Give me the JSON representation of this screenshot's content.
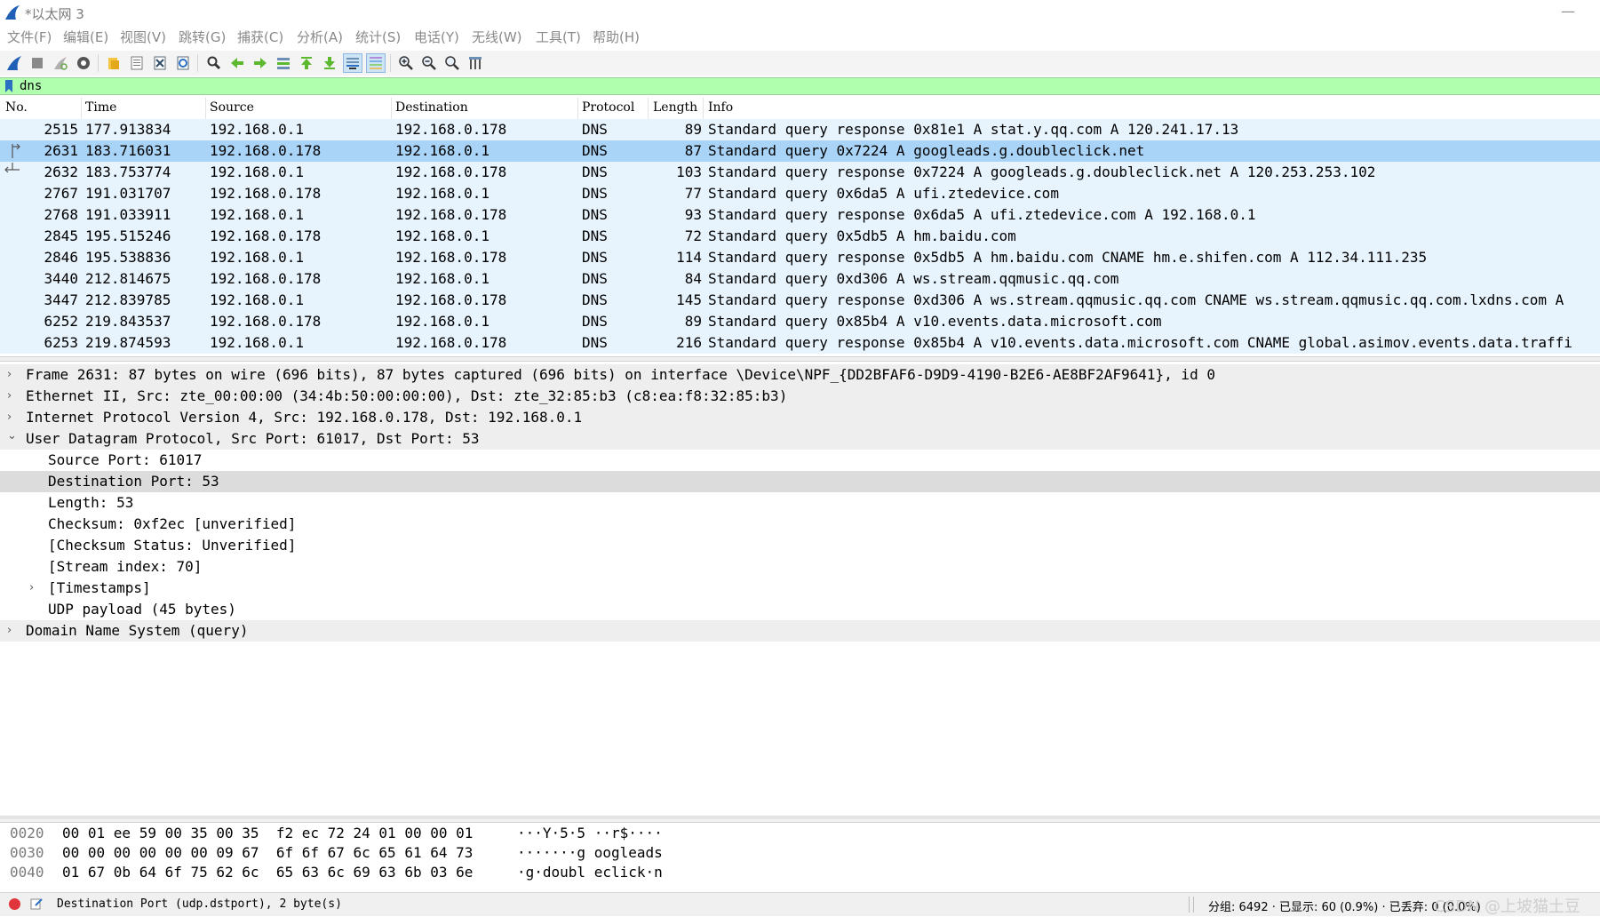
{
  "window": {
    "title": "*以太网 3",
    "minimize": "—"
  },
  "menu": [
    "文件(F)",
    "编辑(E)",
    "视图(V)",
    "跳转(G)",
    "捕获(C)",
    "分析(A)",
    "统计(S)",
    "电话(Y)",
    "无线(W)",
    "工具(T)",
    "帮助(H)"
  ],
  "filter": {
    "value": "dns"
  },
  "packet_list": {
    "columns": [
      "No.",
      "Time",
      "Source",
      "Destination",
      "Protocol",
      "Length",
      "Info"
    ],
    "rows": [
      {
        "no": "2515",
        "time": "177.913834",
        "src": "192.168.0.1",
        "dst": "192.168.0.178",
        "proto": "DNS",
        "len": "89",
        "info": "Standard query response 0x81e1 A stat.y.qq.com A 120.241.17.13"
      },
      {
        "no": "2631",
        "time": "183.716031",
        "src": "192.168.0.178",
        "dst": "192.168.0.1",
        "proto": "DNS",
        "len": "87",
        "info": "Standard query 0x7224 A googleads.g.doubleclick.net"
      },
      {
        "no": "2632",
        "time": "183.753774",
        "src": "192.168.0.1",
        "dst": "192.168.0.178",
        "proto": "DNS",
        "len": "103",
        "info": "Standard query response 0x7224 A googleads.g.doubleclick.net A 120.253.253.102"
      },
      {
        "no": "2767",
        "time": "191.031707",
        "src": "192.168.0.178",
        "dst": "192.168.0.1",
        "proto": "DNS",
        "len": "77",
        "info": "Standard query 0x6da5 A ufi.ztedevice.com"
      },
      {
        "no": "2768",
        "time": "191.033911",
        "src": "192.168.0.1",
        "dst": "192.168.0.178",
        "proto": "DNS",
        "len": "93",
        "info": "Standard query response 0x6da5 A ufi.ztedevice.com A 192.168.0.1"
      },
      {
        "no": "2845",
        "time": "195.515246",
        "src": "192.168.0.178",
        "dst": "192.168.0.1",
        "proto": "DNS",
        "len": "72",
        "info": "Standard query 0x5db5 A hm.baidu.com"
      },
      {
        "no": "2846",
        "time": "195.538836",
        "src": "192.168.0.1",
        "dst": "192.168.0.178",
        "proto": "DNS",
        "len": "114",
        "info": "Standard query response 0x5db5 A hm.baidu.com CNAME hm.e.shifen.com A 112.34.111.235"
      },
      {
        "no": "3440",
        "time": "212.814675",
        "src": "192.168.0.178",
        "dst": "192.168.0.1",
        "proto": "DNS",
        "len": "84",
        "info": "Standard query 0xd306 A ws.stream.qqmusic.qq.com"
      },
      {
        "no": "3447",
        "time": "212.839785",
        "src": "192.168.0.1",
        "dst": "192.168.0.178",
        "proto": "DNS",
        "len": "145",
        "info": "Standard query response 0xd306 A ws.stream.qqmusic.qq.com CNAME ws.stream.qqmusic.qq.com.lxdns.com A"
      },
      {
        "no": "6252",
        "time": "219.843537",
        "src": "192.168.0.178",
        "dst": "192.168.0.1",
        "proto": "DNS",
        "len": "89",
        "info": "Standard query 0x85b4 A v10.events.data.microsoft.com"
      },
      {
        "no": "6253",
        "time": "219.874593",
        "src": "192.168.0.1",
        "dst": "192.168.0.178",
        "proto": "DNS",
        "len": "216",
        "info": "Standard query response 0x85b4 A v10.events.data.microsoft.com CNAME global.asimov.events.data.traffi"
      }
    ]
  },
  "details": [
    {
      "text": "Frame 2631: 87 bytes on wire (696 bits), 87 bytes captured (696 bits) on interface \\Device\\NPF_{DD2BFAF6-D9D9-4190-B2E6-AE8BF2AF9641}, id 0",
      "arrow": "›",
      "level": 0
    },
    {
      "text": "Ethernet II, Src: zte_00:00:00 (34:4b:50:00:00:00), Dst: zte_32:85:b3 (c8:ea:f8:32:85:b3)",
      "arrow": "›",
      "level": 0
    },
    {
      "text": "Internet Protocol Version 4, Src: 192.168.0.178, Dst: 192.168.0.1",
      "arrow": "›",
      "level": 0
    },
    {
      "text": "User Datagram Protocol, Src Port: 61017, Dst Port: 53",
      "arrow": "⌄",
      "level": 0
    },
    {
      "text": "Source Port: 61017",
      "arrow": "",
      "level": 1
    },
    {
      "text": "Destination Port: 53",
      "arrow": "",
      "level": 1
    },
    {
      "text": "Length: 53",
      "arrow": "",
      "level": 1
    },
    {
      "text": "Checksum: 0xf2ec [unverified]",
      "arrow": "",
      "level": 1
    },
    {
      "text": "[Checksum Status: Unverified]",
      "arrow": "",
      "level": 1
    },
    {
      "text": "[Stream index: 70]",
      "arrow": "",
      "level": 1
    },
    {
      "text": "[Timestamps]",
      "arrow": "›",
      "level": 1
    },
    {
      "text": "UDP payload (45 bytes)",
      "arrow": "",
      "level": 1
    },
    {
      "text": "Domain Name System (query)",
      "arrow": "›",
      "level": 0
    }
  ],
  "hex": [
    {
      "offset": "0020",
      "bytes": "00 01 ee 59 00 35 00 35  f2 ec 72 24 01 00 00 01",
      "ascii": "···Y·5·5 ··r$····"
    },
    {
      "offset": "0030",
      "bytes": "00 00 00 00 00 00 09 67  6f 6f 67 6c 65 61 64 73",
      "ascii": "·······g oogleads"
    },
    {
      "offset": "0040",
      "bytes": "01 67 0b 64 6f 75 62 6c  65 63 6c 69 63 6b 03 6e",
      "ascii": "·g·doubl eclick·n"
    }
  ],
  "status": {
    "message": "Destination Port (udp.dstport), 2 byte(s)",
    "stats": "分组: 6492 · 已显示: 60 (0.9%)  · 已丢弃: 0 (0.0%)",
    "watermark": "CSDN @上坡猫土豆"
  }
}
